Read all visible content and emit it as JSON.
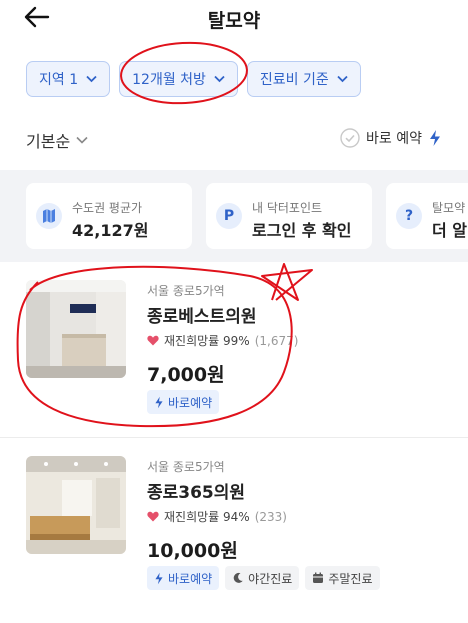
{
  "header": {
    "title": "탈모약"
  },
  "filters": [
    {
      "label": "지역 1"
    },
    {
      "label": "12개월 처방"
    },
    {
      "label": "진료비 기준"
    }
  ],
  "sort": {
    "label": "기본순",
    "quick_booking_label": "바로 예약"
  },
  "info_cards": [
    {
      "label": "수도권 평균가",
      "value": "42,127원",
      "icon": "map-icon"
    },
    {
      "label": "내 닥터포인트",
      "value": "로그인 후 확인",
      "icon": "point-p-icon",
      "icon_text": "P"
    },
    {
      "label": "탈모약",
      "value": "더 알",
      "icon": "question-icon",
      "icon_text": "?"
    }
  ],
  "clinics": [
    {
      "location": "서울 종로5가역",
      "name": "종로베스트의원",
      "rating_label": "재진희망률 99%",
      "rating_count": "(1,677)",
      "price": "7,000원",
      "tags": [
        "바로예약"
      ]
    },
    {
      "location": "서울 종로5가역",
      "name": "종로365의원",
      "rating_label": "재진희망률 94%",
      "rating_count": "(233)",
      "price": "10,000원",
      "tags": [
        "바로예약",
        "야간진료",
        "주말진료"
      ]
    }
  ],
  "colors": {
    "accent": "#2f62c8",
    "chip_bg": "#eef3fd",
    "heart": "#e5506a",
    "annotation": "#e0121b"
  }
}
